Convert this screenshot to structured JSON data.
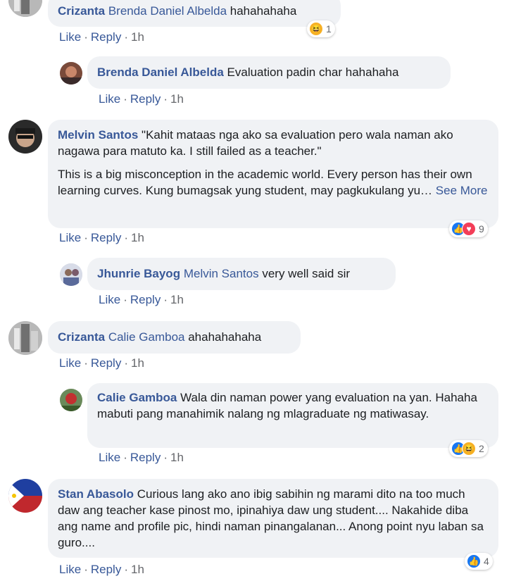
{
  "actions": {
    "like": "Like",
    "reply": "Reply",
    "sep": "·",
    "time": "1h"
  },
  "comments": [
    {
      "author": "Crizanta",
      "tag": "Brenda Daniel Albelda",
      "text": " hahahahaha",
      "reactions": {
        "icons": [
          "haha"
        ],
        "count": "1"
      }
    },
    {
      "author": "Brenda Daniel Albelda",
      "text": " Evaluation padin char hahahaha"
    },
    {
      "author": "Melvin Santos",
      "text": " \"Kahit mataas nga ako sa evaluation pero wala naman ako nagawa para matuto ka. I still failed as a teacher.\"",
      "text2": "This is a big misconception in the academic world. Every person has their own learning curves. Kung bumagsak yung student, may pagkukulang yu…",
      "see_more": "See More",
      "reactions": {
        "icons": [
          "like",
          "love"
        ],
        "count": "9"
      }
    },
    {
      "author": "Jhunrie Bayog",
      "tag": "Melvin Santos",
      "text": " very well said sir"
    },
    {
      "author": "Crizanta",
      "tag": "Calie Gamboa",
      "text": " ahahahahaha"
    },
    {
      "author": "Calie Gamboa",
      "text": " Wala din naman power yang evaluation na yan. Hahaha mabuti pang manahimik nalang ng mlagraduate ng matiwasay.",
      "reactions": {
        "icons": [
          "like",
          "haha"
        ],
        "count": "2"
      }
    },
    {
      "author": "Stan Abasolo",
      "text": " Curious lang ako ano ibig sabihin ng marami dito na too much daw ang teacher kase pinost mo, ipinahiya daw ung student.... Nakahide diba ang name and profile pic, hindi naman pinangalanan... Anong point nyu laban sa guro....",
      "reactions": {
        "icons": [
          "like"
        ],
        "count": "4"
      }
    }
  ]
}
